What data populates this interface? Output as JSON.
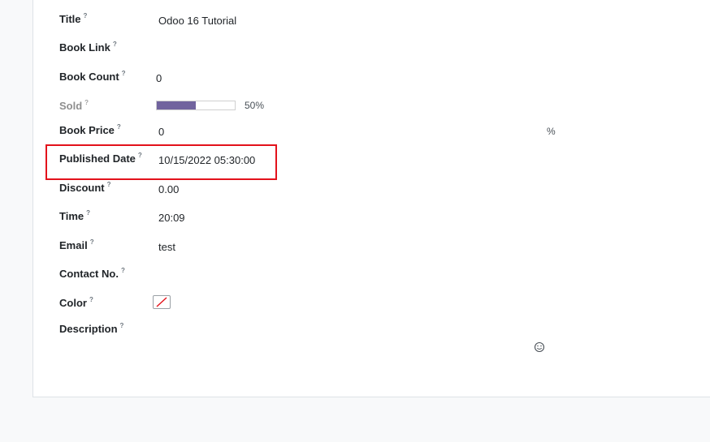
{
  "fields": {
    "title": {
      "label": "Title",
      "help": "?",
      "value": "Odoo 16  Tutorial"
    },
    "book_link": {
      "label": "Book Link",
      "help": "?",
      "value": ""
    },
    "book_count": {
      "label": "Book Count",
      "help": "?",
      "value": "0"
    },
    "sold": {
      "label": "Sold",
      "help": "?",
      "progress": 0.5,
      "progress_text": "50%"
    },
    "book_price": {
      "label": "Book Price",
      "help": "?",
      "value": "0",
      "suffix": "%"
    },
    "published_date": {
      "label": "Published Date",
      "help": "?",
      "value": "10/15/2022 05:30:00"
    },
    "discount": {
      "label": "Discount",
      "help": "?",
      "value": "0.00"
    },
    "time": {
      "label": "Time",
      "help": "?",
      "value": "20:09"
    },
    "email": {
      "label": "Email",
      "help": "?",
      "value": "test"
    },
    "contact_no": {
      "label": "Contact No.",
      "help": "?",
      "value": ""
    },
    "color": {
      "label": "Color",
      "help": "?",
      "swatch": "none"
    },
    "description": {
      "label": "Description",
      "help": "?",
      "value": ""
    }
  },
  "icons": {
    "emoji": "emoji-icon",
    "color_none": "no-color-icon"
  },
  "colors": {
    "progress_fill": "#71639e",
    "highlight_border": "#e3121b",
    "no_color_slash": "#e3121b"
  }
}
